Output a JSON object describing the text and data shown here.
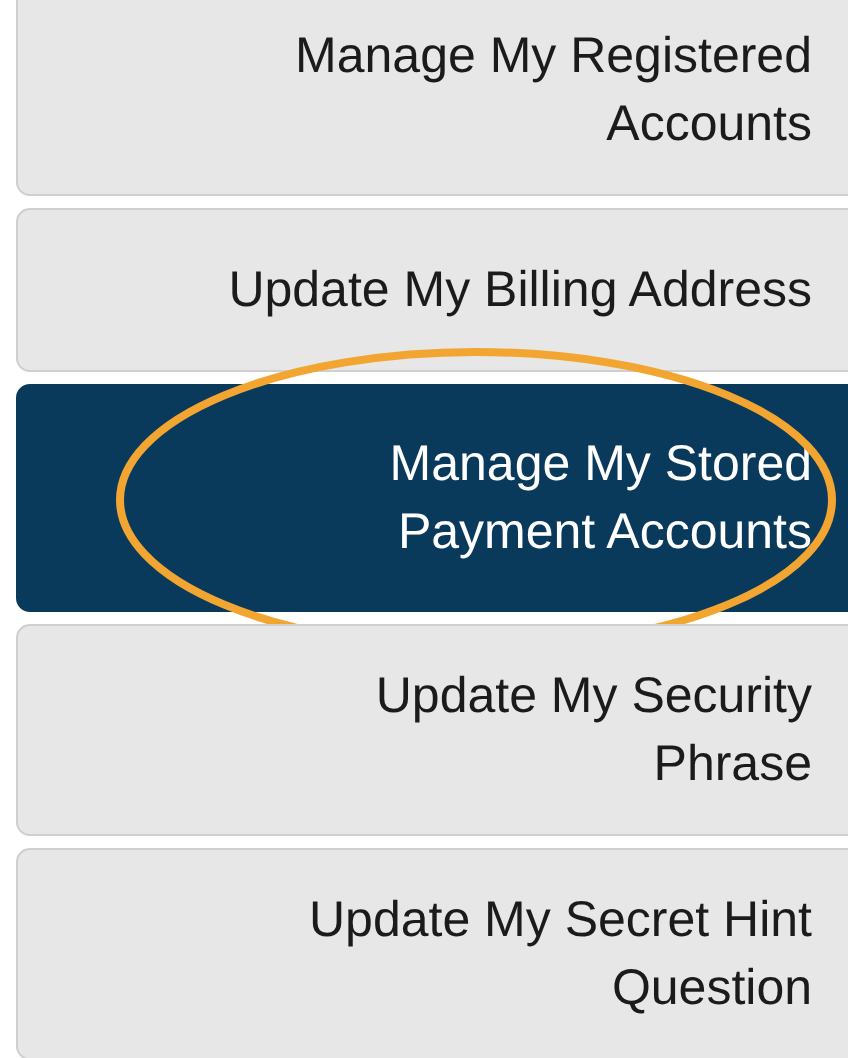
{
  "menu": {
    "items": [
      {
        "lines": [
          "Manage My Registered",
          "Accounts"
        ],
        "selected": false,
        "circled": false
      },
      {
        "lines": [
          "Update My Billing Address"
        ],
        "selected": false,
        "circled": false
      },
      {
        "lines": [
          "Manage My Stored",
          "Payment Accounts"
        ],
        "selected": true,
        "circled": true
      },
      {
        "lines": [
          "Update My Security",
          "Phrase"
        ],
        "selected": false,
        "circled": false
      },
      {
        "lines": [
          "Update My Secret Hint",
          "Question"
        ],
        "selected": false,
        "circled": false
      }
    ]
  }
}
